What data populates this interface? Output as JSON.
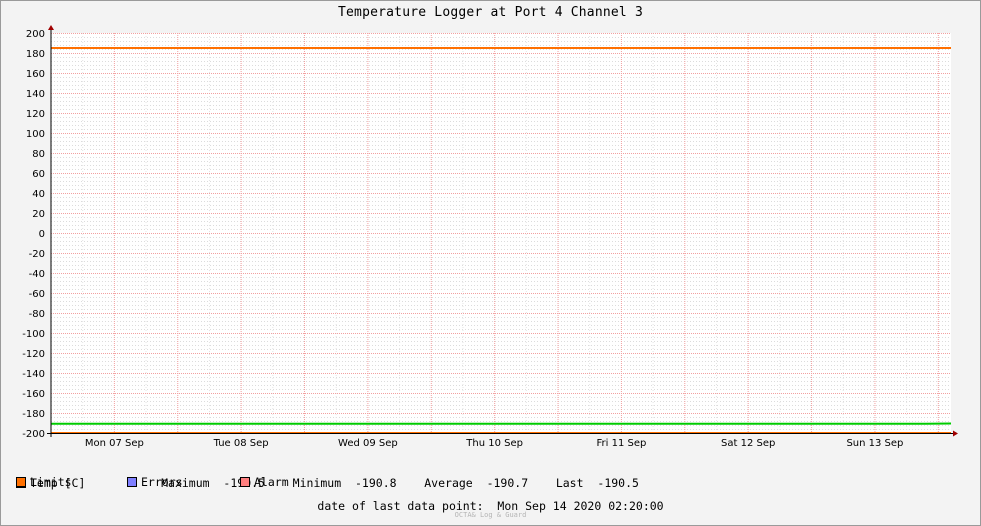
{
  "chart_data": {
    "type": "line",
    "title": "Temperature Logger at Port 4 Channel 3",
    "ylim": [
      -200,
      200
    ],
    "yticks": [
      200,
      180,
      160,
      140,
      120,
      100,
      80,
      60,
      40,
      20,
      0,
      -20,
      -40,
      -60,
      -80,
      -100,
      -120,
      -140,
      -160,
      -180,
      -200
    ],
    "xticks": [
      "Mon 07 Sep",
      "Tue 08 Sep",
      "Wed 09 Sep",
      "Thu 10 Sep",
      "Fri 11 Sep",
      "Sat 12 Sep",
      "Sun 13 Sep"
    ],
    "x_range_days": [
      0,
      7.1
    ],
    "grid": true,
    "series": [
      {
        "name": "Temp [C]",
        "color": "#00cc00",
        "x": [
          0,
          6.9,
          7.0,
          7.1
        ],
        "y": [
          -190.8,
          -190.7,
          -190.6,
          -190.5
        ]
      },
      {
        "name": "Limits",
        "color": "#ff7000",
        "x": [
          0,
          7.1
        ],
        "y": [
          185,
          185
        ]
      },
      {
        "name": "Limits",
        "color": "#ff7000",
        "x": [
          0,
          7.1
        ],
        "y": [
          -200,
          -200
        ]
      }
    ],
    "legend": [
      {
        "name": "Temp [C]",
        "color": "#00ff00"
      },
      {
        "name": "Limits",
        "color": "#ff7000"
      },
      {
        "name": "Errors",
        "color": "#7f7fff"
      },
      {
        "name": "Alarm",
        "color": "#ff7f7f"
      }
    ]
  },
  "stats": {
    "max_label": "Maximum",
    "max_value": "-190.5",
    "min_label": "Minimum",
    "min_value": "-190.8",
    "avg_label": "Average",
    "avg_value": "-190.7",
    "last_label": "Last",
    "last_value": "-190.5"
  },
  "last_data_point": "date of last data point:  Mon Sep 14 2020 02:20:00",
  "brand": "OCTA& Log & Guard"
}
